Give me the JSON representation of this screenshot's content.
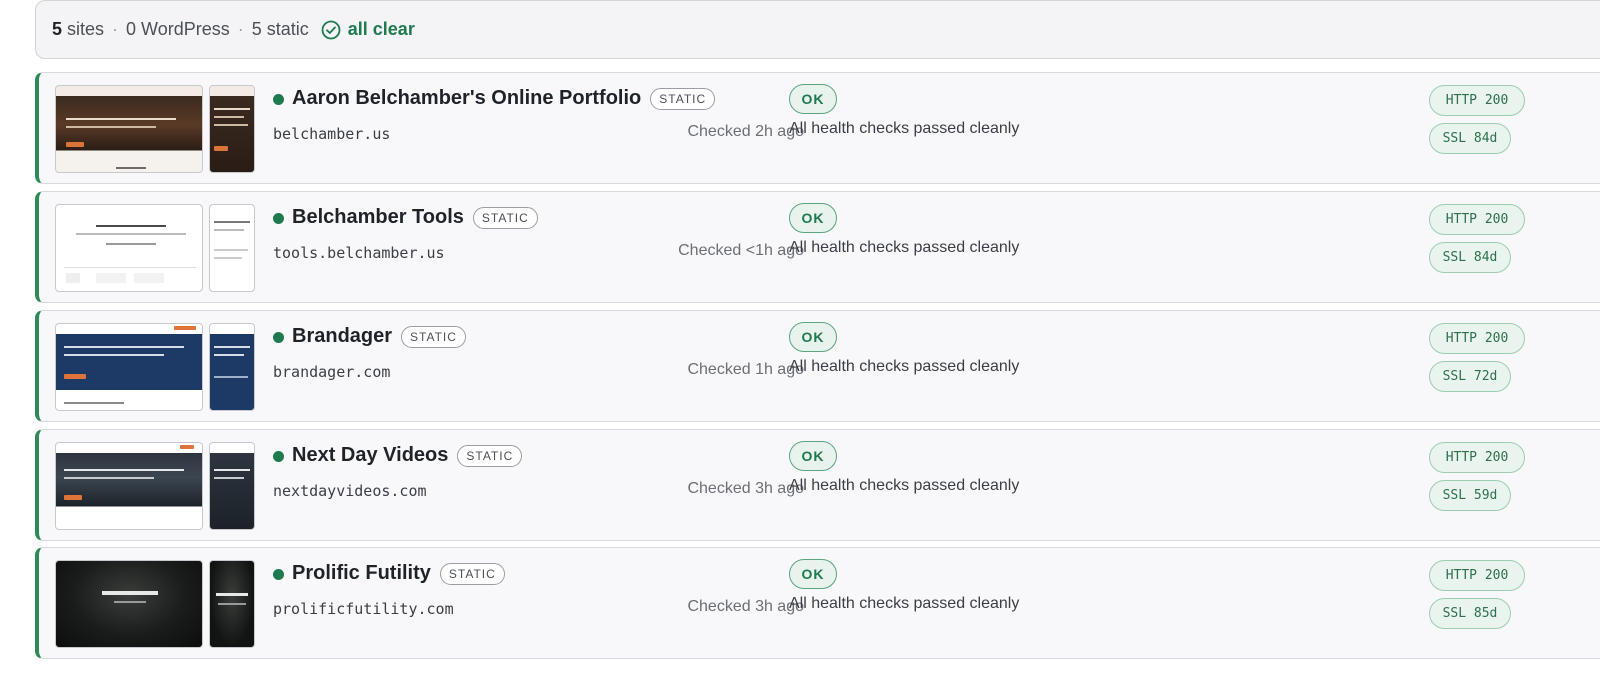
{
  "summary": {
    "sites_count": "5",
    "sites_label": "sites",
    "sep": "·",
    "wordpress": "0 WordPress",
    "static": "5 static",
    "status": "all clear"
  },
  "sites": [
    {
      "name": "Aaron Belchamber's Online Portfolio",
      "type": "STATIC",
      "domain": "belchamber.us",
      "checked": "Checked 2h ago",
      "status": "OK",
      "message": "All health checks passed cleanly",
      "http": "HTTP 200",
      "ssl": "SSL 84d"
    },
    {
      "name": "Belchamber Tools",
      "type": "STATIC",
      "domain": "tools.belchamber.us",
      "checked": "Checked <1h ago",
      "status": "OK",
      "message": "All health checks passed cleanly",
      "http": "HTTP 200",
      "ssl": "SSL 84d"
    },
    {
      "name": "Brandager",
      "type": "STATIC",
      "domain": "brandager.com",
      "checked": "Checked 1h ago",
      "status": "OK",
      "message": "All health checks passed cleanly",
      "http": "HTTP 200",
      "ssl": "SSL 72d"
    },
    {
      "name": "Next Day Videos",
      "type": "STATIC",
      "domain": "nextdayvideos.com",
      "checked": "Checked 3h ago",
      "status": "OK",
      "message": "All health checks passed cleanly",
      "http": "HTTP 200",
      "ssl": "SSL 59d"
    },
    {
      "name": "Prolific Futility",
      "type": "STATIC",
      "domain": "prolificfutility.com",
      "checked": "Checked 3h ago",
      "status": "OK",
      "message": "All health checks passed cleanly",
      "http": "HTTP 200",
      "ssl": "SSL 85d"
    }
  ],
  "colors": {
    "ok_green": "#1e7a4f",
    "card_accent": "#2e8b57"
  },
  "icons": {
    "all_clear": "check-circle-icon",
    "status": "status-dot-icon"
  }
}
